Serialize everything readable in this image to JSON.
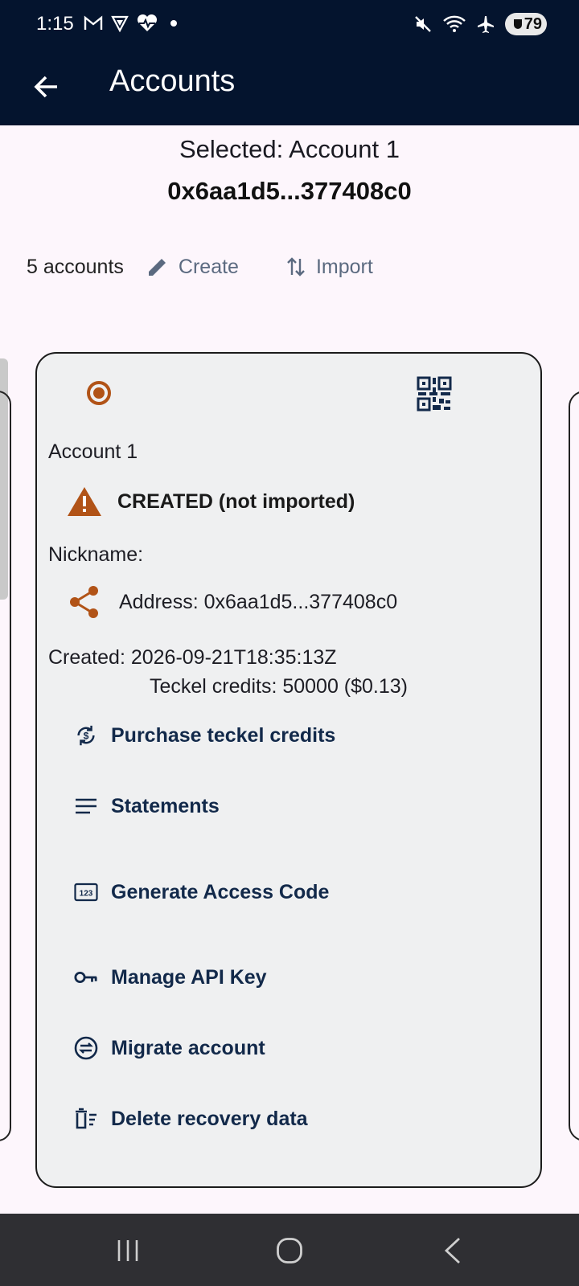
{
  "status_bar": {
    "time": "1:15",
    "left_icons": [
      "gmail-icon",
      "vpn-shield-icon",
      "heart-monitor-icon",
      "dot-icon"
    ],
    "right_icons": [
      "mute-icon",
      "wifi-icon",
      "airplane-icon"
    ],
    "battery": "79"
  },
  "app_bar": {
    "title": "Accounts"
  },
  "header": {
    "selected_label": "Selected: Account 1",
    "selected_address": "0x6aa1d5...377408c0"
  },
  "toolbar": {
    "count": "5 accounts",
    "create_label": "Create",
    "import_label": "Import"
  },
  "card": {
    "account_name": "Account 1",
    "status": "CREATED (not imported)",
    "nickname_label": "Nickname:",
    "address": "Address: 0x6aa1d5...377408c0",
    "created": "Created: 2026-09-21T18:35:13Z",
    "credits": "Teckel credits: 50000 ($0.13)",
    "actions": [
      {
        "label": "Purchase teckel credits",
        "icon": "currency-exchange-icon"
      },
      {
        "label": "Statements",
        "icon": "lines-icon"
      },
      {
        "label": "Generate Access Code",
        "icon": "numbers-123-icon"
      },
      {
        "label": "Manage API Key",
        "icon": "key-icon"
      },
      {
        "label": "Migrate account",
        "icon": "swap-circle-icon"
      },
      {
        "label": "Delete recovery data",
        "icon": "delete-sweep-icon"
      }
    ]
  },
  "colors": {
    "app_bar": "#04142e",
    "accent_orange": "#b15317",
    "action_text": "#12294a",
    "secondary_button": "#5b6a80"
  }
}
